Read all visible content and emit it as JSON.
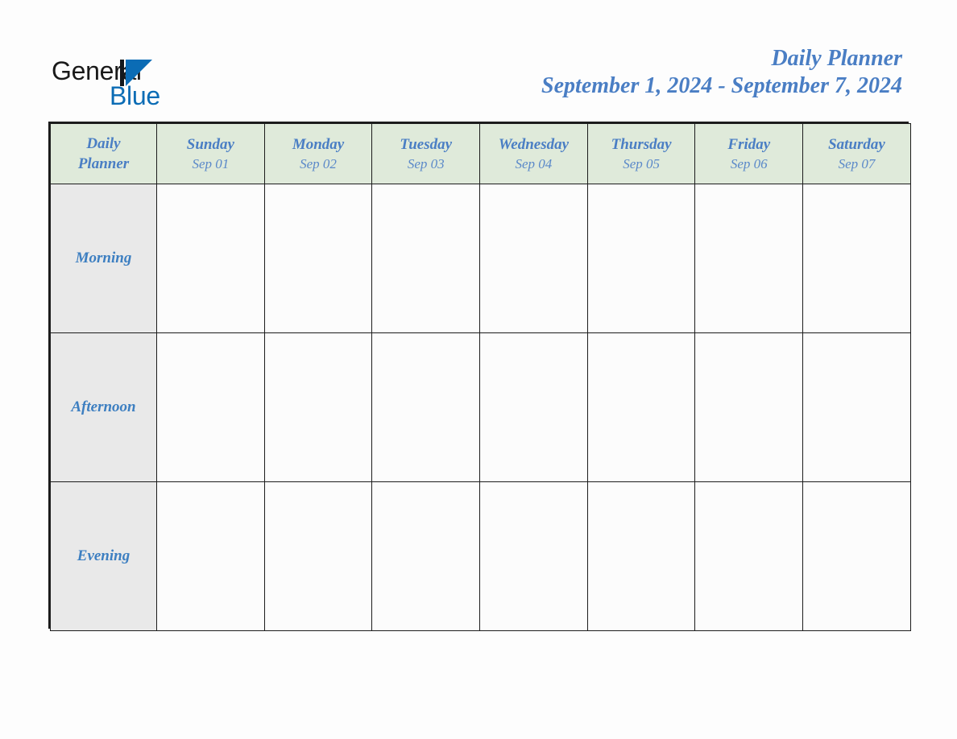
{
  "brand": {
    "name_part1": "General",
    "name_part2": "Blue",
    "logo_icon": "blue-flag-triangle",
    "blue_hex": "#0b6cb5"
  },
  "header": {
    "title": "Daily Planner",
    "date_range": "September 1, 2024 - September 7, 2024",
    "accent_hex": "#4a7ec4"
  },
  "planner": {
    "corner_label_line1": "Daily",
    "corner_label_line2": "Planner",
    "header_bg_hex": "#dfeada",
    "row_label_bg_hex": "#e9e9e9",
    "cell_bg_hex": "#fcfcfc",
    "border_hex": "#1c1c1c",
    "days": [
      {
        "name": "Sunday",
        "date": "Sep 01"
      },
      {
        "name": "Monday",
        "date": "Sep 02"
      },
      {
        "name": "Tuesday",
        "date": "Sep 03"
      },
      {
        "name": "Wednesday",
        "date": "Sep 04"
      },
      {
        "name": "Thursday",
        "date": "Sep 05"
      },
      {
        "name": "Friday",
        "date": "Sep 06"
      },
      {
        "name": "Saturday",
        "date": "Sep 07"
      }
    ],
    "slots": [
      {
        "label": "Morning",
        "entries": [
          "",
          "",
          "",
          "",
          "",
          "",
          ""
        ]
      },
      {
        "label": "Afternoon",
        "entries": [
          "",
          "",
          "",
          "",
          "",
          "",
          ""
        ]
      },
      {
        "label": "Evening",
        "entries": [
          "",
          "",
          "",
          "",
          "",
          "",
          ""
        ]
      }
    ]
  }
}
